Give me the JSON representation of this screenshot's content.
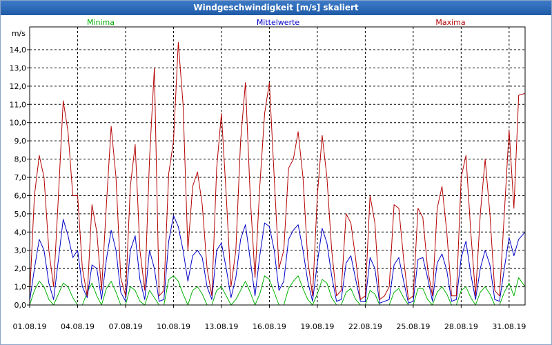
{
  "window": {
    "title": "Windgeschwindigkeit [m/s] skaliert"
  },
  "chart_data": {
    "type": "line",
    "title": "Windgeschwindigkeit [m/s] skaliert",
    "ylabel": "m/s",
    "xlabel": "",
    "ylim": [
      0,
      14.5
    ],
    "xlim": [
      0,
      31
    ],
    "x_unit": "days since 01.08.19 00:00",
    "yticks": [
      "0,0",
      "1,0",
      "2,0",
      "3,0",
      "4,0",
      "5,0",
      "6,0",
      "7,0",
      "8,0",
      "9,0",
      "10,0",
      "11,0",
      "12,0",
      "13,0",
      "14,0"
    ],
    "xticks": [
      {
        "x": 0,
        "label": "01.08.19"
      },
      {
        "x": 3,
        "label": "04.08.19"
      },
      {
        "x": 6,
        "label": "07.08.19"
      },
      {
        "x": 9,
        "label": "10.08.19"
      },
      {
        "x": 12,
        "label": "13.08.19"
      },
      {
        "x": 15,
        "label": "16.08.19"
      },
      {
        "x": 18,
        "label": "19.08.19"
      },
      {
        "x": 21,
        "label": "22.08.19"
      },
      {
        "x": 24,
        "label": "25.08.19"
      },
      {
        "x": 27,
        "label": "28.08.19"
      },
      {
        "x": 30,
        "label": "31.08.19"
      }
    ],
    "grid": true,
    "legend_position": "top",
    "series": [
      {
        "name": "Minima",
        "color": "#00b000",
        "x": [
          0.0,
          0.3,
          0.6,
          0.9,
          1.2,
          1.5,
          1.8,
          2.1,
          2.4,
          2.7,
          3.0,
          3.3,
          3.6,
          3.9,
          4.2,
          4.5,
          4.8,
          5.1,
          5.4,
          5.7,
          6.0,
          6.3,
          6.6,
          6.9,
          7.2,
          7.5,
          7.8,
          8.1,
          8.4,
          8.7,
          9.0,
          9.3,
          9.6,
          9.9,
          10.2,
          10.5,
          10.8,
          11.1,
          11.4,
          11.7,
          12.0,
          12.3,
          12.6,
          12.9,
          13.2,
          13.5,
          13.8,
          14.1,
          14.4,
          14.7,
          15.0,
          15.3,
          15.6,
          15.9,
          16.2,
          16.5,
          16.8,
          17.1,
          17.4,
          17.7,
          18.0,
          18.3,
          18.6,
          18.9,
          19.2,
          19.5,
          19.8,
          20.1,
          20.4,
          20.7,
          21.0,
          21.3,
          21.6,
          21.9,
          22.2,
          22.5,
          22.8,
          23.1,
          23.4,
          23.7,
          24.0,
          24.3,
          24.6,
          24.9,
          25.2,
          25.5,
          25.8,
          26.1,
          26.4,
          26.7,
          27.0,
          27.3,
          27.6,
          27.9,
          28.2,
          28.5,
          28.8,
          29.1,
          29.4,
          29.7,
          30.0,
          30.3,
          30.6,
          31.0
        ],
        "y": [
          0.0,
          0.8,
          1.3,
          1.0,
          0.3,
          0.0,
          0.6,
          1.2,
          1.0,
          0.4,
          0.0,
          0.0,
          0.7,
          1.2,
          0.5,
          0.0,
          0.9,
          1.3,
          0.7,
          0.0,
          0.0,
          1.0,
          0.8,
          0.2,
          0.0,
          0.8,
          0.4,
          0.0,
          0.0,
          1.4,
          1.6,
          1.3,
          0.6,
          0.0,
          0.8,
          1.0,
          0.6,
          0.0,
          0.0,
          0.8,
          1.0,
          0.5,
          0.0,
          0.3,
          0.8,
          1.3,
          0.7,
          0.0,
          0.6,
          1.6,
          1.4,
          0.7,
          0.0,
          0.0,
          0.9,
          1.3,
          1.6,
          0.9,
          0.3,
          0.0,
          0.6,
          1.4,
          1.2,
          0.4,
          0.0,
          0.0,
          0.7,
          0.9,
          0.3,
          0.0,
          0.0,
          0.8,
          0.6,
          0.0,
          0.0,
          0.0,
          0.7,
          0.9,
          0.4,
          0.0,
          0.0,
          0.9,
          0.9,
          0.3,
          0.0,
          0.7,
          1.0,
          0.6,
          0.0,
          0.0,
          0.8,
          1.0,
          0.4,
          0.0,
          0.7,
          1.0,
          0.6,
          0.0,
          0.0,
          0.7,
          1.2,
          0.5,
          1.5,
          1.0
        ]
      },
      {
        "name": "Mittelwerte",
        "color": "#0000c8",
        "x": [
          0.0,
          0.3,
          0.6,
          0.9,
          1.2,
          1.5,
          1.8,
          2.1,
          2.4,
          2.7,
          3.0,
          3.3,
          3.6,
          3.9,
          4.2,
          4.5,
          4.8,
          5.1,
          5.4,
          5.7,
          6.0,
          6.3,
          6.6,
          6.9,
          7.2,
          7.5,
          7.8,
          8.1,
          8.4,
          8.7,
          9.0,
          9.3,
          9.6,
          9.9,
          10.2,
          10.5,
          10.8,
          11.1,
          11.4,
          11.7,
          12.0,
          12.3,
          12.6,
          12.9,
          13.2,
          13.5,
          13.8,
          14.1,
          14.4,
          14.7,
          15.0,
          15.3,
          15.6,
          15.9,
          16.2,
          16.5,
          16.8,
          17.1,
          17.4,
          17.7,
          18.0,
          18.3,
          18.6,
          18.9,
          19.2,
          19.5,
          19.8,
          20.1,
          20.4,
          20.7,
          21.0,
          21.3,
          21.6,
          21.9,
          22.2,
          22.5,
          22.8,
          23.1,
          23.4,
          23.7,
          24.0,
          24.3,
          24.6,
          24.9,
          25.2,
          25.5,
          25.8,
          26.1,
          26.4,
          26.7,
          27.0,
          27.3,
          27.6,
          27.9,
          28.2,
          28.5,
          28.8,
          29.1,
          29.4,
          29.7,
          30.0,
          30.3,
          30.6,
          31.0
        ],
        "y": [
          0.2,
          2.0,
          3.6,
          3.0,
          1.2,
          0.3,
          2.5,
          4.7,
          3.8,
          2.6,
          3.0,
          1.0,
          0.4,
          2.2,
          2.0,
          0.3,
          2.5,
          4.1,
          3.0,
          0.7,
          0.2,
          3.0,
          3.8,
          1.4,
          0.3,
          3.0,
          2.0,
          0.2,
          0.3,
          3.5,
          4.9,
          4.3,
          3.0,
          1.3,
          2.7,
          3.0,
          2.6,
          1.0,
          0.3,
          3.0,
          3.4,
          2.0,
          0.4,
          1.5,
          3.6,
          4.4,
          2.5,
          0.5,
          2.7,
          4.5,
          4.3,
          3.0,
          0.8,
          1.3,
          3.6,
          4.1,
          4.4,
          3.0,
          1.3,
          0.2,
          2.3,
          4.2,
          3.4,
          1.6,
          0.2,
          0.3,
          2.3,
          2.7,
          1.4,
          0.2,
          0.2,
          2.6,
          2.0,
          0.1,
          0.2,
          0.3,
          2.2,
          2.6,
          1.3,
          0.1,
          0.2,
          2.5,
          2.6,
          1.5,
          0.2,
          2.3,
          2.8,
          1.9,
          0.2,
          0.3,
          2.6,
          3.5,
          1.7,
          0.3,
          2.0,
          3.0,
          2.2,
          0.3,
          0.2,
          2.0,
          3.7,
          2.7,
          3.6,
          4.0
        ]
      },
      {
        "name": "Maxima",
        "color": "#b40000",
        "x": [
          0.0,
          0.3,
          0.6,
          0.9,
          1.2,
          1.5,
          1.8,
          2.1,
          2.4,
          2.7,
          3.0,
          3.3,
          3.6,
          3.9,
          4.2,
          4.5,
          4.8,
          5.1,
          5.4,
          5.7,
          6.0,
          6.3,
          6.6,
          6.9,
          7.2,
          7.5,
          7.8,
          8.1,
          8.4,
          8.7,
          9.0,
          9.3,
          9.6,
          9.9,
          10.2,
          10.5,
          10.8,
          11.1,
          11.4,
          11.7,
          12.0,
          12.3,
          12.6,
          12.9,
          13.2,
          13.5,
          13.8,
          14.1,
          14.4,
          14.7,
          15.0,
          15.3,
          15.6,
          15.9,
          16.2,
          16.5,
          16.8,
          17.1,
          17.4,
          17.7,
          18.0,
          18.3,
          18.6,
          18.9,
          19.2,
          19.5,
          19.8,
          20.1,
          20.4,
          20.7,
          21.0,
          21.3,
          21.6,
          21.9,
          22.2,
          22.5,
          22.8,
          23.1,
          23.4,
          23.7,
          24.0,
          24.3,
          24.6,
          24.9,
          25.2,
          25.5,
          25.8,
          26.1,
          26.4,
          26.7,
          27.0,
          27.3,
          27.6,
          27.9,
          28.2,
          28.5,
          28.8,
          29.1,
          29.4,
          29.7,
          30.0,
          30.3,
          30.6,
          31.0
        ],
        "y": [
          0.5,
          6.0,
          8.2,
          7.0,
          3.0,
          1.0,
          6.0,
          11.2,
          9.5,
          6.0,
          6.0,
          2.0,
          0.5,
          5.5,
          4.0,
          0.8,
          5.5,
          9.8,
          7.0,
          1.5,
          0.5,
          6.5,
          8.8,
          3.0,
          0.8,
          8.0,
          13.0,
          0.5,
          0.8,
          7.2,
          9.0,
          14.4,
          11.0,
          3.0,
          6.5,
          7.3,
          5.5,
          2.0,
          0.5,
          7.5,
          10.5,
          6.0,
          1.0,
          3.0,
          9.0,
          12.2,
          6.0,
          1.5,
          6.5,
          10.5,
          12.2,
          7.0,
          2.0,
          3.0,
          7.5,
          8.0,
          9.5,
          7.0,
          2.5,
          0.5,
          6.0,
          9.3,
          7.0,
          3.0,
          0.5,
          0.8,
          5.0,
          4.5,
          2.5,
          0.3,
          0.5,
          6.0,
          4.5,
          0.3,
          0.5,
          1.0,
          5.5,
          5.3,
          2.5,
          0.3,
          0.5,
          5.3,
          4.8,
          2.0,
          0.5,
          5.3,
          6.5,
          4.0,
          0.5,
          0.5,
          7.0,
          8.2,
          4.0,
          0.5,
          5.0,
          8.0,
          5.0,
          0.8,
          0.5,
          5.0,
          9.6,
          5.3,
          11.5,
          11.6
        ]
      }
    ]
  }
}
